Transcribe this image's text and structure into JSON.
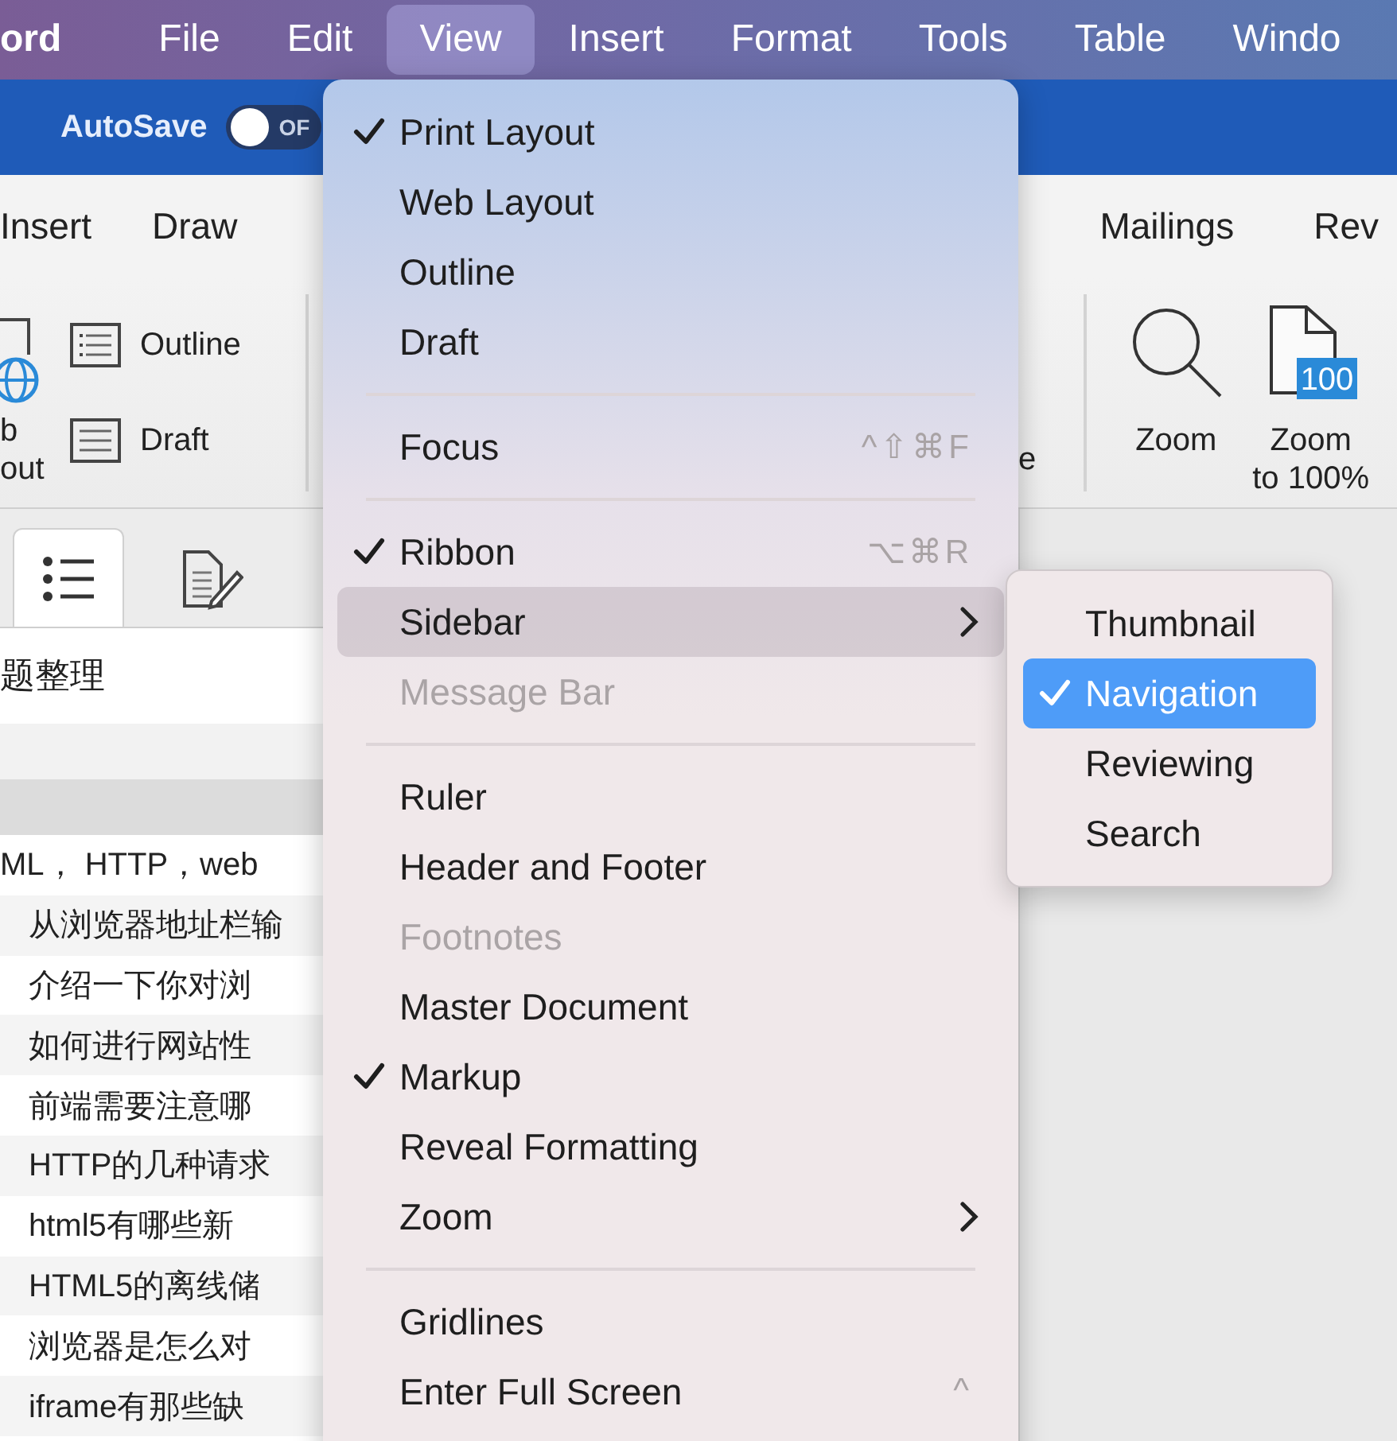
{
  "menu_bar": [
    {
      "label": "ord",
      "selected": false,
      "kind": "app"
    },
    {
      "label": "File",
      "selected": false,
      "kind": "menu"
    },
    {
      "label": "Edit",
      "selected": false,
      "kind": "menu"
    },
    {
      "label": "View",
      "selected": true,
      "kind": "menu"
    },
    {
      "label": "Insert",
      "selected": false,
      "kind": "menu"
    },
    {
      "label": "Format",
      "selected": false,
      "kind": "menu"
    },
    {
      "label": "Tools",
      "selected": false,
      "kind": "menu"
    },
    {
      "label": "Table",
      "selected": false,
      "kind": "menu"
    },
    {
      "label": "Windo",
      "selected": false,
      "kind": "menu"
    }
  ],
  "title_bar": {
    "autosave_label": "AutoSave",
    "autosave_on": false,
    "toggle_text": "OF"
  },
  "ribbon_tabs_left": [
    "Insert",
    "Draw"
  ],
  "ribbon_tabs_right": [
    "Mailings",
    "Rev"
  ],
  "ribbon_left": {
    "cut_button_lines": [
      "b",
      "out"
    ],
    "buttons": [
      {
        "label": "Outline",
        "kind": "outline"
      },
      {
        "label": "Draft",
        "kind": "draft"
      }
    ]
  },
  "ribbon_right": {
    "cut_label": "e",
    "buttons": [
      {
        "lines": [
          "Zoom"
        ],
        "kind": "zoom"
      },
      {
        "lines": [
          "Zoom",
          "to 100%"
        ],
        "kind": "zoom100",
        "badge": "100"
      }
    ]
  },
  "sidebar": {
    "tabs": [
      {
        "kind": "list",
        "selected": true
      },
      {
        "kind": "edit",
        "selected": false
      }
    ],
    "title": "题整理",
    "outline": [
      {
        "text": "ML， HTTP，web",
        "children": [
          {
            "text": "从浏览器地址栏输"
          },
          {
            "text": "介绍一下你对浏"
          },
          {
            "text": "如何进行网站性"
          },
          {
            "text": "前端需要注意哪"
          },
          {
            "text": "HTTP的几种请求"
          },
          {
            "text": "html5有哪些新"
          },
          {
            "text": "HTML5的离线储"
          },
          {
            "text": "浏览器是怎么对"
          },
          {
            "text": "iframe有那些缺"
          }
        ]
      }
    ]
  },
  "view_menu": {
    "groups": [
      [
        {
          "label": "Print Layout",
          "checked": true,
          "disabled": false,
          "selected": false
        },
        {
          "label": "Web Layout",
          "checked": false,
          "disabled": false,
          "selected": false
        },
        {
          "label": "Outline",
          "checked": false,
          "disabled": false,
          "selected": false
        },
        {
          "label": "Draft",
          "checked": false,
          "disabled": false,
          "selected": false
        }
      ],
      [
        {
          "label": "Focus",
          "checked": false,
          "disabled": false,
          "selected": false,
          "shortcut": "^⇧⌘F"
        }
      ],
      [
        {
          "label": "Ribbon",
          "checked": true,
          "disabled": false,
          "selected": false,
          "shortcut": "⌥⌘R"
        },
        {
          "label": "Sidebar",
          "checked": false,
          "disabled": false,
          "selected": true,
          "submenu": true
        },
        {
          "label": "Message Bar",
          "checked": false,
          "disabled": true,
          "selected": false
        }
      ],
      [
        {
          "label": "Ruler",
          "checked": false,
          "disabled": false,
          "selected": false
        },
        {
          "label": "Header and Footer",
          "checked": false,
          "disabled": false,
          "selected": false
        },
        {
          "label": "Footnotes",
          "checked": false,
          "disabled": true,
          "selected": false
        },
        {
          "label": "Master Document",
          "checked": false,
          "disabled": false,
          "selected": false
        },
        {
          "label": "Markup",
          "checked": true,
          "disabled": false,
          "selected": false
        },
        {
          "label": "Reveal Formatting",
          "checked": false,
          "disabled": false,
          "selected": false
        },
        {
          "label": "Zoom",
          "checked": false,
          "disabled": false,
          "selected": false,
          "submenu": true
        }
      ],
      [
        {
          "label": "Gridlines",
          "checked": false,
          "disabled": false,
          "selected": false
        },
        {
          "label": "Enter Full Screen",
          "checked": false,
          "disabled": false,
          "selected": false,
          "shortcut": "^"
        }
      ]
    ]
  },
  "sidebar_submenu": [
    {
      "label": "Thumbnail",
      "checked": false,
      "selected": false
    },
    {
      "label": "Navigation",
      "checked": true,
      "selected": true
    },
    {
      "label": "Reviewing",
      "checked": false,
      "selected": false
    },
    {
      "label": "Search",
      "checked": false,
      "selected": false
    }
  ]
}
